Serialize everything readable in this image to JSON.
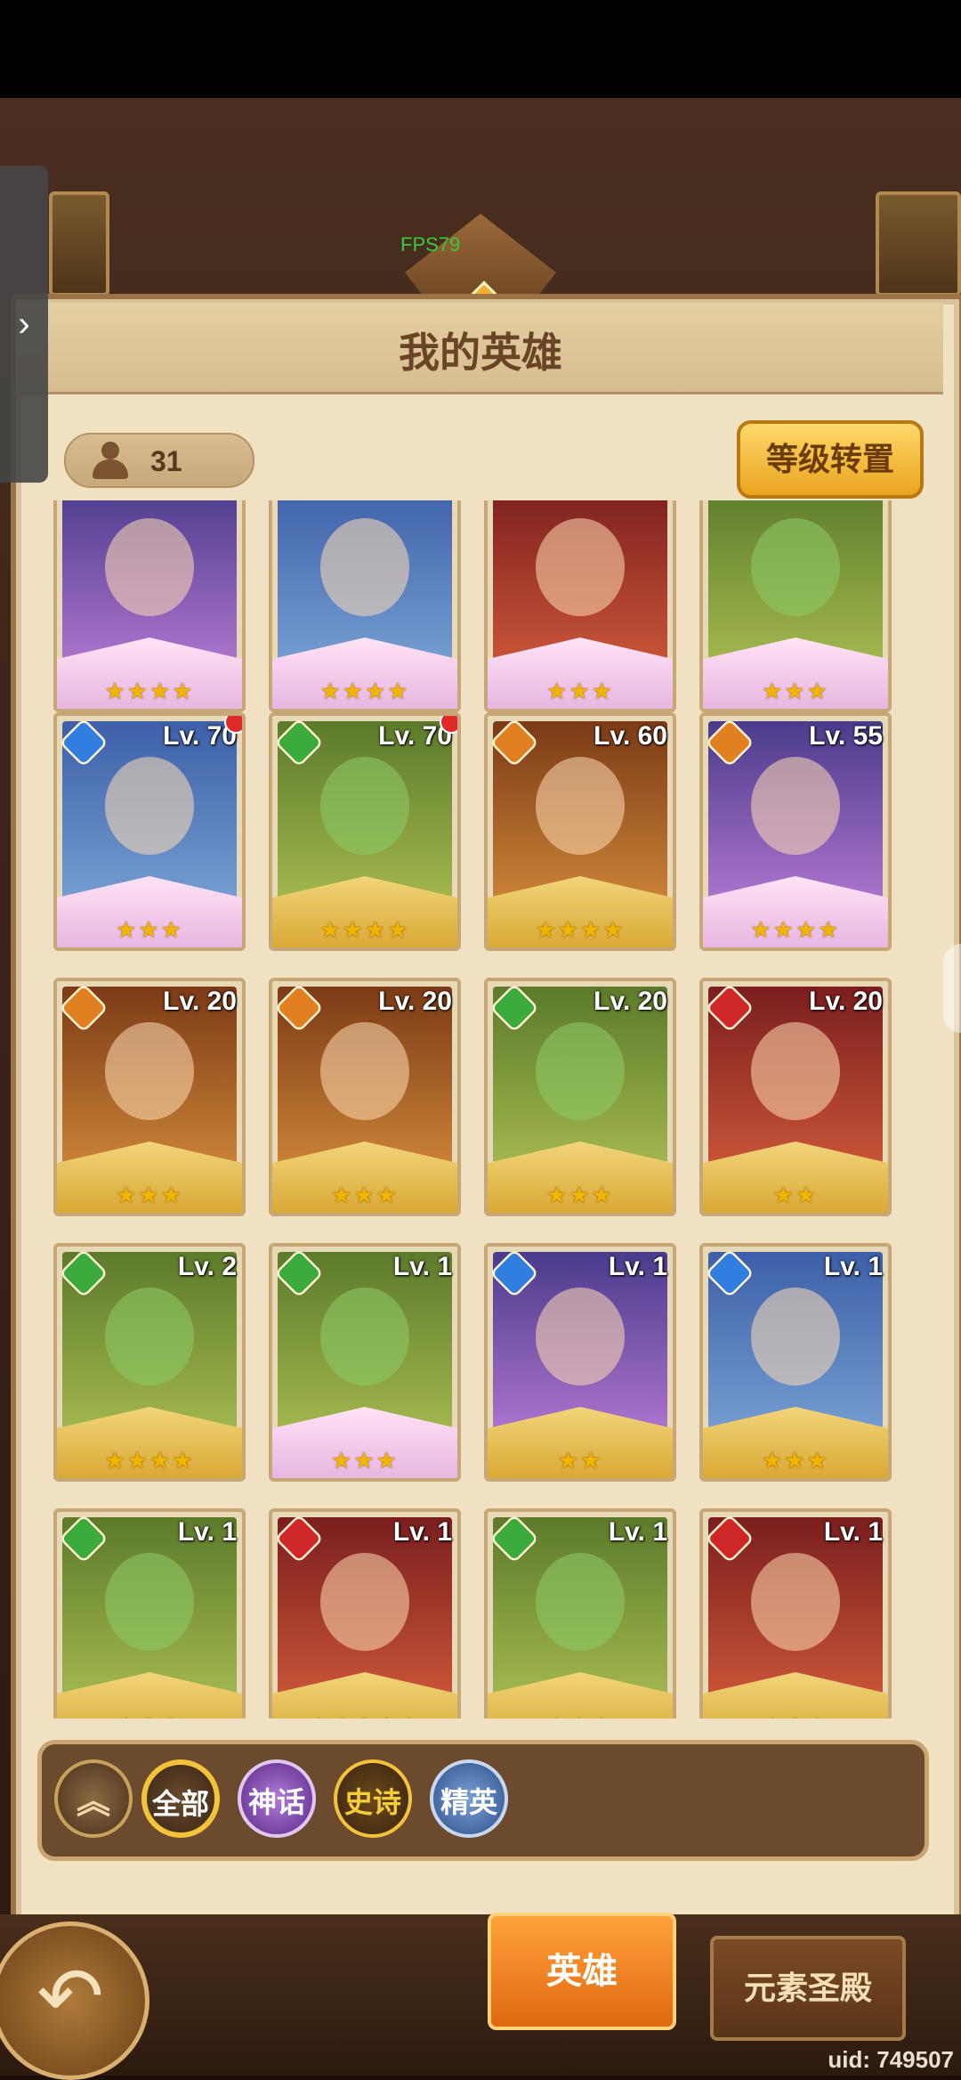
{
  "overlay": {
    "fps": "FPS79",
    "side_tab_icon": "chevron-right-icon"
  },
  "header": {
    "title": "我的英雄",
    "hero_count": "31",
    "reset_button": "等级转置"
  },
  "rows": [
    [
      {
        "level": "",
        "element": "",
        "stars": "★★★★",
        "color": "p-purple",
        "mythic": true,
        "dot": false
      },
      {
        "level": "",
        "element": "",
        "stars": "★★★★",
        "color": "p-blue",
        "mythic": true,
        "dot": false
      },
      {
        "level": "",
        "element": "",
        "stars": "★★★",
        "color": "p-red",
        "mythic": true,
        "dot": false
      },
      {
        "level": "",
        "element": "",
        "stars": "★★★",
        "color": "p-green",
        "mythic": true,
        "dot": false
      }
    ],
    [
      {
        "level": "Lv. 70",
        "element": "water",
        "stars": "★★★",
        "color": "p-blue",
        "mythic": true,
        "dot": true
      },
      {
        "level": "Lv. 70",
        "element": "nature",
        "stars": "★★★★",
        "color": "p-green",
        "mythic": false,
        "dot": true
      },
      {
        "level": "Lv. 60",
        "element": "fire",
        "stars": "★★★★",
        "color": "p-orange",
        "mythic": false,
        "dot": false
      },
      {
        "level": "Lv. 55",
        "element": "fire",
        "stars": "★★★★",
        "color": "p-purple",
        "mythic": true,
        "dot": false
      }
    ],
    [
      {
        "level": "Lv. 20",
        "element": "fire",
        "stars": "★★★",
        "color": "p-orange",
        "mythic": false,
        "dot": false
      },
      {
        "level": "Lv. 20",
        "element": "fire",
        "stars": "★★★",
        "color": "p-orange",
        "mythic": false,
        "dot": false
      },
      {
        "level": "Lv. 20",
        "element": "nature",
        "stars": "★★★",
        "color": "p-green",
        "mythic": false,
        "dot": false
      },
      {
        "level": "Lv. 20",
        "element": "blood",
        "stars": "★★",
        "color": "p-red",
        "mythic": false,
        "dot": false
      }
    ],
    [
      {
        "level": "Lv. 2",
        "element": "nature",
        "stars": "★★★★",
        "color": "p-green",
        "mythic": false,
        "dot": false
      },
      {
        "level": "Lv. 1",
        "element": "nature",
        "stars": "★★★",
        "color": "p-green",
        "mythic": true,
        "dot": false
      },
      {
        "level": "Lv. 1",
        "element": "water",
        "stars": "★★",
        "color": "p-purple",
        "mythic": false,
        "dot": false
      },
      {
        "level": "Lv. 1",
        "element": "water",
        "stars": "★★★",
        "color": "p-blue",
        "mythic": false,
        "dot": false
      }
    ],
    [
      {
        "level": "Lv. 1",
        "element": "nature",
        "stars": "★★★",
        "color": "p-green",
        "mythic": false,
        "dot": false
      },
      {
        "level": "Lv. 1",
        "element": "blood",
        "stars": "★★★★★",
        "color": "p-red",
        "mythic": false,
        "dot": false
      },
      {
        "level": "Lv. 1",
        "element": "nature",
        "stars": "★★★",
        "color": "p-green",
        "mythic": false,
        "dot": false
      },
      {
        "level": "Lv. 1",
        "element": "blood",
        "stars": "★★★",
        "color": "p-red",
        "mythic": false,
        "dot": false
      }
    ]
  ],
  "filters": {
    "up": "︽",
    "all": "全部",
    "mythic": "神话",
    "epic": "史诗",
    "elite": "精英"
  },
  "bottom": {
    "back_icon": "back-arrow-icon",
    "tab_heroes": "英雄",
    "tab_element": "元素圣殿",
    "uid": "uid: 749507"
  },
  "colors": {
    "water": "#2f7ee0",
    "nature": "#3aaa3a",
    "fire": "#e08020",
    "blood": "#d02828",
    "accent": "#f3c33a"
  }
}
